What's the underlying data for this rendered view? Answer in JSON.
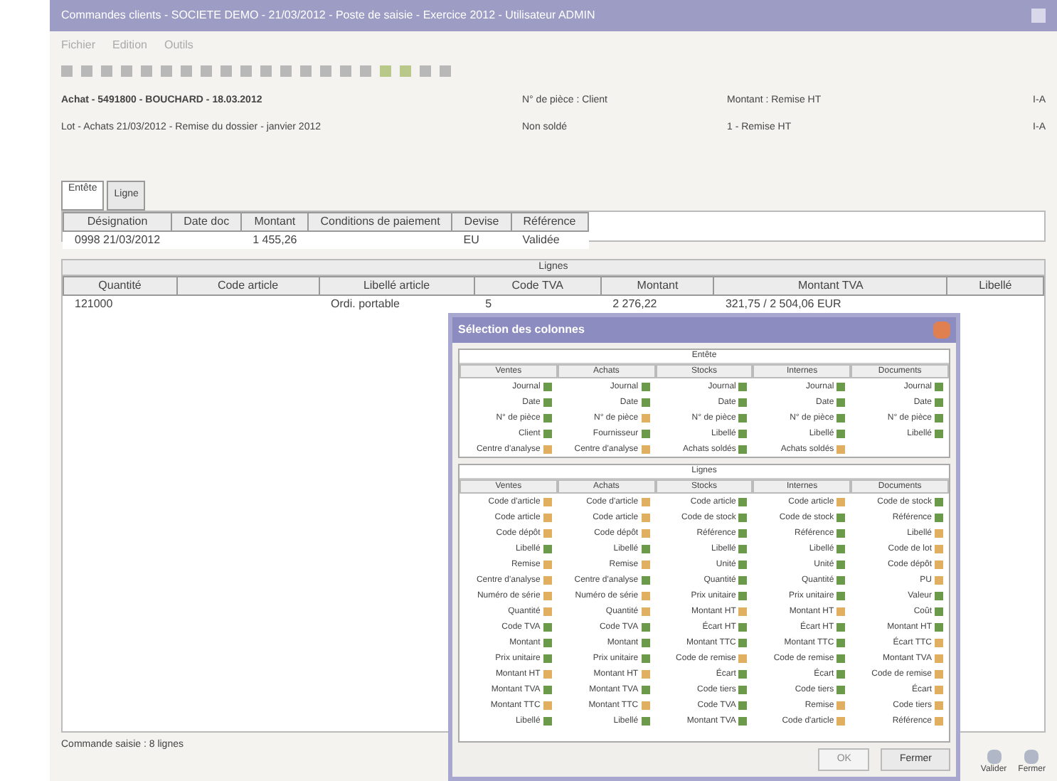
{
  "window": {
    "title": "Commandes clients - SOCIETE DEMO - 21/03/2012 - Poste de saisie - Exercice 2012 - Utilisateur ADMIN"
  },
  "menu": [
    "Fichier",
    "Edition",
    "Outils"
  ],
  "header": {
    "title": "Achat - 5491800 - BOUCHARD - 18.03.2012",
    "subtitle": "Lot - Achats 21/03/2012 - Remise du dossier - janvier 2012",
    "fields": [
      {
        "label": "N° de pièce : Client",
        "value": "Non soldé"
      },
      {
        "label": "Montant : Remise HT",
        "value": "1 - Remise HT"
      }
    ],
    "cut": [
      "I-A",
      "I-A"
    ]
  },
  "tabs": [
    {
      "label": "Entête",
      "selected": true
    },
    {
      "label": "Ligne",
      "selected": false
    }
  ],
  "table1": {
    "columns": [
      "Désignation",
      "Date doc",
      "Montant",
      "Conditions de paiement",
      "Devise",
      "Référence"
    ],
    "rows": [
      [
        "0998 21/03/2012",
        "",
        "1 455,26",
        "",
        "EU",
        "Validée"
      ]
    ]
  },
  "table2": {
    "group": "Lignes",
    "columns": [
      "Quantité",
      "Code article",
      "Libellé article",
      "Code TVA",
      "Montant",
      "Montant TVA",
      "Libellé"
    ],
    "rows": [
      [
        "121000",
        "",
        "Ordi. portable",
        "5",
        "2 276,22",
        "321,75 / 2 504,06 EUR",
        ""
      ]
    ]
  },
  "status": "Commande saisie : 8 lignes",
  "bottom_buttons": [
    "Valider",
    "Fermer"
  ],
  "dialog": {
    "title": "Sélection des colonnes",
    "sections": [
      {
        "title": "Entête",
        "columns": [
          "Ventes",
          "Achats",
          "Stocks",
          "Internes",
          "Documents"
        ],
        "rows": [
          [
            {
              "text": "Journal",
              "checked": true
            },
            {
              "text": "Journal",
              "checked": true
            },
            {
              "text": "Journal",
              "checked": true
            },
            {
              "text": "Journal",
              "checked": true
            },
            {
              "text": "Journal",
              "checked": true
            }
          ],
          [
            {
              "text": "Date",
              "checked": true
            },
            {
              "text": "Date",
              "checked": true
            },
            {
              "text": "Date",
              "checked": true
            },
            {
              "text": "Date",
              "checked": true
            },
            {
              "text": "Date",
              "checked": true
            }
          ],
          [
            {
              "text": "N° de pièce",
              "checked": true
            },
            {
              "text": "N° de pièce",
              "checked": false
            },
            {
              "text": "N° de pièce",
              "checked": true
            },
            {
              "text": "N° de pièce",
              "checked": true
            },
            {
              "text": "N° de pièce",
              "checked": true
            }
          ],
          [
            {
              "text": "Client",
              "checked": true
            },
            {
              "text": "Fournisseur",
              "checked": true
            },
            {
              "text": "Libellé",
              "checked": true
            },
            {
              "text": "Libellé",
              "checked": true
            },
            {
              "text": "Libellé",
              "checked": true
            }
          ],
          [
            {
              "text": "Centre d'analyse",
              "checked": false
            },
            {
              "text": "Centre d'analyse",
              "checked": false
            },
            {
              "text": "Achats soldés",
              "checked": true
            },
            {
              "text": "Achats soldés",
              "checked": false
            }
          ]
        ]
      },
      {
        "title": "Lignes",
        "columns": [
          "Ventes",
          "Achats",
          "Stocks",
          "Internes",
          "Documents"
        ],
        "rows": [
          [
            {
              "text": "Code d'article",
              "checked": false
            },
            {
              "text": "Code d'article",
              "checked": false
            },
            {
              "text": "Code article",
              "checked": true
            },
            {
              "text": "Code article",
              "checked": false
            },
            {
              "text": "Code de stock",
              "checked": true
            }
          ],
          [
            {
              "text": "Code article",
              "checked": false
            },
            {
              "text": "Code article",
              "checked": false
            },
            {
              "text": "Code de stock",
              "checked": true
            },
            {
              "text": "Code de stock",
              "checked": true
            },
            {
              "text": "Référence",
              "checked": true
            }
          ],
          [
            {
              "text": "Code dépôt",
              "checked": false
            },
            {
              "text": "Code dépôt",
              "checked": false
            },
            {
              "text": "Référence",
              "checked": true
            },
            {
              "text": "Référence",
              "checked": true
            },
            {
              "text": "Libellé",
              "checked": false
            }
          ],
          [
            {
              "text": "Libellé",
              "checked": true
            },
            {
              "text": "Libellé",
              "checked": true
            },
            {
              "text": "Libellé",
              "checked": true
            },
            {
              "text": "Libellé",
              "checked": true
            },
            {
              "text": "Code de lot",
              "checked": false
            }
          ],
          [
            {
              "text": "Remise",
              "checked": false
            },
            {
              "text": "Remise",
              "checked": false
            },
            {
              "text": "Unité",
              "checked": true
            },
            {
              "text": "Unité",
              "checked": true
            },
            {
              "text": "Code dépôt",
              "checked": false
            }
          ],
          [
            {
              "text": "Centre d'analyse",
              "checked": false
            },
            {
              "text": "Centre d'analyse",
              "checked": true
            },
            {
              "text": "Quantité",
              "checked": true
            },
            {
              "text": "Quantité",
              "checked": true
            },
            {
              "text": "PU",
              "checked": false
            }
          ],
          [
            {
              "text": "Numéro de série",
              "checked": false
            },
            {
              "text": "Numéro de série",
              "checked": false
            },
            {
              "text": "Prix unitaire",
              "checked": true
            },
            {
              "text": "Prix unitaire",
              "checked": true
            },
            {
              "text": "Valeur",
              "checked": true
            }
          ],
          [
            {
              "text": "Quantité",
              "checked": false
            },
            {
              "text": "Quantité",
              "checked": false
            },
            {
              "text": "Montant HT",
              "checked": false
            },
            {
              "text": "Montant HT",
              "checked": false
            },
            {
              "text": "Coût",
              "checked": true
            }
          ],
          [
            {
              "text": "Code TVA",
              "checked": true
            },
            {
              "text": "Code TVA",
              "checked": true
            },
            {
              "text": "Écart HT",
              "checked": true
            },
            {
              "text": "Écart HT",
              "checked": true
            },
            {
              "text": "Montant HT",
              "checked": true
            }
          ],
          [
            {
              "text": "Montant",
              "checked": true
            },
            {
              "text": "Montant",
              "checked": true
            },
            {
              "text": "Montant TTC",
              "checked": true
            },
            {
              "text": "Montant TTC",
              "checked": true
            },
            {
              "text": "Écart TTC",
              "checked": false
            }
          ],
          [
            {
              "text": "Prix unitaire",
              "checked": true
            },
            {
              "text": "Prix unitaire",
              "checked": true
            },
            {
              "text": "Code de remise",
              "checked": false
            },
            {
              "text": "Code de remise",
              "checked": true
            },
            {
              "text": "Montant TVA",
              "checked": false
            }
          ],
          [
            {
              "text": "Montant HT",
              "checked": false
            },
            {
              "text": "Montant HT",
              "checked": false
            },
            {
              "text": "Écart",
              "checked": true
            },
            {
              "text": "Écart",
              "checked": true
            },
            {
              "text": "Code de remise",
              "checked": false
            }
          ],
          [
            {
              "text": "Montant TVA",
              "checked": true
            },
            {
              "text": "Montant TVA",
              "checked": true
            },
            {
              "text": "Code tiers",
              "checked": true
            },
            {
              "text": "Code tiers",
              "checked": true
            },
            {
              "text": "Écart",
              "checked": false
            }
          ],
          [
            {
              "text": "Montant TTC",
              "checked": false
            },
            {
              "text": "Montant TTC",
              "checked": false
            },
            {
              "text": "Code TVA",
              "checked": true
            },
            {
              "text": "Remise",
              "checked": false
            },
            {
              "text": "Code tiers",
              "checked": false
            }
          ],
          [
            {
              "text": "Libellé",
              "checked": true
            },
            {
              "text": "Libellé",
              "checked": true
            },
            {
              "text": "Montant TVA",
              "checked": true
            },
            {
              "text": "Code d'article",
              "checked": false
            },
            {
              "text": "Référence",
              "checked": false
            }
          ]
        ]
      }
    ],
    "buttons": [
      {
        "label": "OK",
        "disabled": true
      },
      {
        "label": "Fermer",
        "disabled": false
      }
    ]
  }
}
